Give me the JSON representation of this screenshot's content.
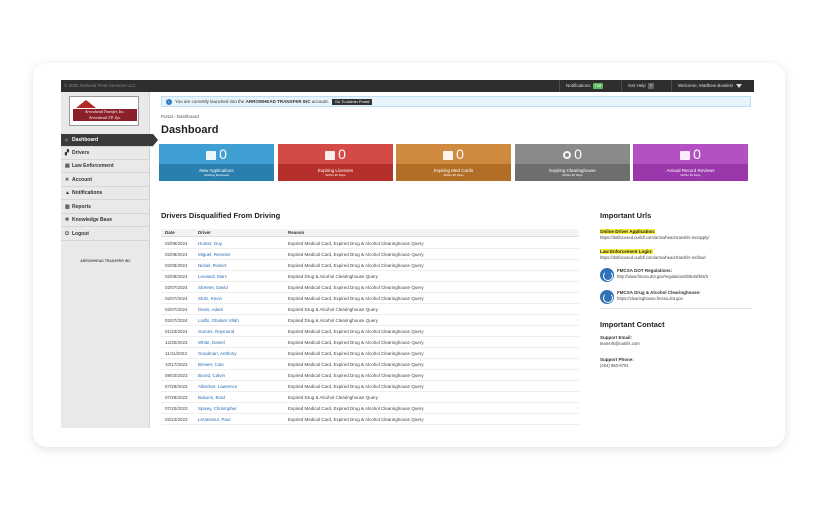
{
  "topbar": {
    "copyright": "© 2025 National Fleet Services LLC",
    "notifications_label": "Notifications",
    "notifications_count": "738",
    "help_label": "Get Help",
    "help_count": "?",
    "welcome": "Welcome, Matthew Bowles!"
  },
  "logo": {
    "line1": "Arrowhead Transfer, Inc.",
    "line2": "Arrowhead T.P. Sys."
  },
  "sidebar": {
    "items": [
      {
        "label": "Dashboard",
        "icon": "home-icon"
      },
      {
        "label": "Drivers",
        "icon": "users-icon"
      },
      {
        "label": "Law Enforcement",
        "icon": "badge-icon"
      },
      {
        "label": "Account",
        "icon": "wrench-icon"
      },
      {
        "label": "Notifications",
        "icon": "alert-icon"
      },
      {
        "label": "Reports",
        "icon": "chart-icon"
      },
      {
        "label": "Knowledge Base",
        "icon": "gear-icon"
      },
      {
        "label": "Logout",
        "icon": "power-icon"
      }
    ],
    "footer_title": "ARROWHEAD TRANSFER INC"
  },
  "notice": {
    "prefix": "You are currently launched into the",
    "company": "ARROWHEAD TRANSFER INC",
    "suffix": "account.",
    "button": "Go To Admin Portal"
  },
  "breadcrumb": {
    "portal": "Portal",
    "sep": "›",
    "current": "Dashboard"
  },
  "page_title": "Dashboard",
  "tiles": [
    {
      "count": "0",
      "label": "New Applications",
      "sub": "Awaiting Reviewed",
      "color_top": "#3f9fd3",
      "color_bot": "#2a7fae"
    },
    {
      "count": "0",
      "label": "Expiring Licenses",
      "sub": "Within 30 Days",
      "color_top": "#d44b46",
      "color_bot": "#b5302b"
    },
    {
      "count": "0",
      "label": "Expiring Med Cards",
      "sub": "Within 30 Days",
      "color_top": "#d08a3f",
      "color_bot": "#b26e26"
    },
    {
      "count": "0",
      "label": "Expiring Clearinghouse",
      "sub": "Within 30 Days",
      "color_top": "#8a8a8a",
      "color_bot": "#6e6e6e"
    },
    {
      "count": "0",
      "label": "Annual Record Reviews",
      "sub": "Within 30 Days",
      "color_top": "#b54fc4",
      "color_bot": "#9a37aa"
    }
  ],
  "disqualified": {
    "title": "Drivers Disqualified From Driving",
    "columns": [
      "Date",
      "Driver",
      "Reason"
    ],
    "rows": [
      [
        "02/08/2024",
        "Hunter, Guy",
        "Expired Medical Card, Expired Drug & Alcohol Clearinghouse Query"
      ],
      [
        "02/08/2024",
        "Miguel, Reinnier",
        "Expired Medical Card, Expired Drug & Alcohol Clearinghouse Query"
      ],
      [
        "02/08/2024",
        "Nickel, Robert",
        "Expired Medical Card, Expired Drug & Alcohol Clearinghouse Query"
      ],
      [
        "02/08/2024",
        "Leonard, Marc",
        "Expired Drug & Alcohol Clearinghouse Query"
      ],
      [
        "02/07/2024",
        "Streeter, David",
        "Expired Medical Card, Expired Drug & Alcohol Clearinghouse Query"
      ],
      [
        "02/07/2024",
        "Stutz, Kevin",
        "Expired Medical Card, Expired Drug & Alcohol Clearinghouse Query"
      ],
      [
        "02/07/2024",
        "Davis, Adam",
        "Expired Drug & Alcohol Clearinghouse Query"
      ],
      [
        "02/07/2024",
        "Lodhi, Ghulam Ullah",
        "Expired Drug & Alcohol Clearinghouse Query"
      ],
      [
        "01/23/2024",
        "Gomes, Raymond",
        "Expired Medical Card, Expired Drug & Alcohol Clearinghouse Query"
      ],
      [
        "12/20/2023",
        "White, Daniel",
        "Expired Medical Card, Expired Drug & Alcohol Clearinghouse Query"
      ],
      [
        "11/11/2023",
        "Goodman, Anthony",
        "Expired Medical Card, Expired Drug & Alcohol Clearinghouse Query"
      ],
      [
        "10/17/2023",
        "Brewer, Cole",
        "Expired Medical Card, Expired Drug & Alcohol Clearinghouse Query"
      ],
      [
        "08/03/2023",
        "Boord, Calvin",
        "Expired Medical Card, Expired Drug & Alcohol Clearinghouse Query"
      ],
      [
        "07/28/2023",
        "Albecker, Lawrence",
        "Expired Medical Card, Expired Drug & Alcohol Clearinghouse Query"
      ],
      [
        "07/28/2023",
        "Bukumi, Brad",
        "Expired Drug & Alcohol Clearinghouse Query"
      ],
      [
        "07/20/2023",
        "Spivey, Christopher",
        "Expired Medical Card, Expired Drug & Alcohol Clearinghouse Query"
      ],
      [
        "02/24/2023",
        "LeVasseur, Paul",
        "Expired Medical Card, Expired Drug & Alcohol Clearinghouse Query"
      ],
      [
        "01/14/2023",
        "Guy, David",
        "Expired Medical Card, Expired Drug & Alcohol Clearinghouse Query"
      ],
      [
        "12/24/2022",
        "Wood, David",
        "Expired Medical Card, Expired Drug & Alcohol Clearinghouse Query"
      ]
    ]
  },
  "urls": {
    "title": "Important Urls",
    "online_label": "Online Driver Application:",
    "online_url": "https://dotfocused.ourldf.com/arrowhead-transfer-inc/apply/",
    "law_label": "Law Enforcement Login:",
    "law_url": "https://dotfocused.ourldf.com/arrowhead-transfer-inc/law/",
    "fmcsa_label": "FMCSA DOT Regulations:",
    "fmcsa_url": "http://www.fmcsa.dot.gov/regulations/title49/b/5/3",
    "ch_label": "FMCSA Drug & Alcohol Clearinghouse:",
    "ch_url": "https://clearinghouse.fmcsa.dot.gov"
  },
  "contact": {
    "title": "Important Contact",
    "email_label": "Support Email:",
    "email": "teamnfs@natnfs.com",
    "phone_label": "Support Phone:",
    "phone": "(404) 850-8701"
  }
}
